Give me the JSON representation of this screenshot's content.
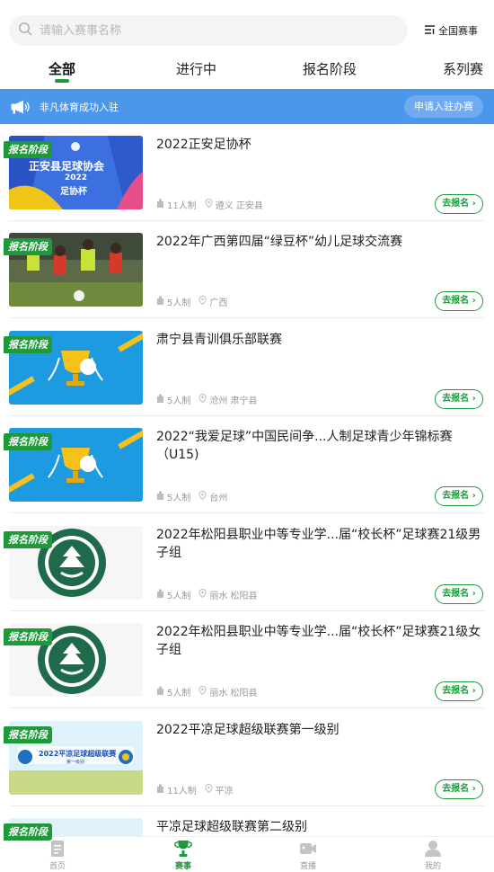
{
  "search": {
    "placeholder": "请输入赛事名称",
    "icon": "search-icon"
  },
  "filter": {
    "label": "全国赛事",
    "icon": "filter-icon"
  },
  "tabs": [
    {
      "label": "全部",
      "active": true
    },
    {
      "label": "进行中",
      "active": false
    },
    {
      "label": "报名阶段",
      "active": false
    },
    {
      "label": "系列赛",
      "active": false
    }
  ],
  "notice": {
    "text": "非凡体育成功入驻",
    "button": "申请入驻办赛",
    "icon": "megaphone-icon"
  },
  "items": [
    {
      "badge": "报名阶段",
      "title": "2022正安足协杯",
      "players": "11人制",
      "location": "遵义 正安县",
      "action": "去报名 ›",
      "thumb_type": "poster-blue",
      "thumb_text_1": "正安县足球协会",
      "thumb_text_2": "2022",
      "thumb_text_3": "足协杯"
    },
    {
      "badge": "报名阶段",
      "title": "2022年广西第四届“绿豆杯”幼儿足球交流赛",
      "players": "5人制",
      "location": "广西",
      "action": "去报名 ›",
      "thumb_type": "photo-kids"
    },
    {
      "badge": "报名阶段",
      "title": "肃宁县青训俱乐部联赛",
      "players": "5人制",
      "location": "沧州 肃宁县",
      "action": "去报名 ›",
      "thumb_type": "trophy"
    },
    {
      "badge": "报名阶段",
      "title": "2022“我爱足球”中国民间争...人制足球青少年锦标赛（U15)",
      "players": "5人制",
      "location": "台州",
      "action": "去报名 ›",
      "thumb_type": "trophy"
    },
    {
      "badge": "报名阶段",
      "title": "2022年松阳县职业中等专业学...届“校长杯”足球赛21级男子组",
      "players": "5人制",
      "location": "丽水 松阳县",
      "action": "去报名 ›",
      "thumb_type": "school-logo"
    },
    {
      "badge": "报名阶段",
      "title": "2022年松阳县职业中等专业学...届“校长杯”足球赛21级女子组",
      "players": "5人制",
      "location": "丽水 松阳县",
      "action": "去报名 ›",
      "thumb_type": "school-logo"
    },
    {
      "badge": "报名阶段",
      "title": "2022平凉足球超级联赛第一级别",
      "players": "11人制",
      "location": "平凉",
      "action": "去报名 ›",
      "thumb_type": "league-banner",
      "thumb_text_1": "2022平凉足球超级联赛",
      "thumb_text_2": "第一级别"
    },
    {
      "badge": "报名阶段",
      "title": "平凉足球超级联赛第二级别",
      "players": "",
      "location": "",
      "action": "",
      "thumb_type": "league-banner"
    }
  ],
  "bottom_nav": [
    {
      "label": "首页",
      "icon": "home-icon",
      "active": false
    },
    {
      "label": "赛事",
      "icon": "trophy-icon",
      "active": true
    },
    {
      "label": "直播",
      "icon": "live-icon",
      "active": false
    },
    {
      "label": "我的",
      "icon": "profile-icon",
      "active": false
    }
  ],
  "colors": {
    "brand_green": "#1f9a3b",
    "notice_blue": "#4a97ec",
    "meta_gray": "#9a9a9a"
  }
}
